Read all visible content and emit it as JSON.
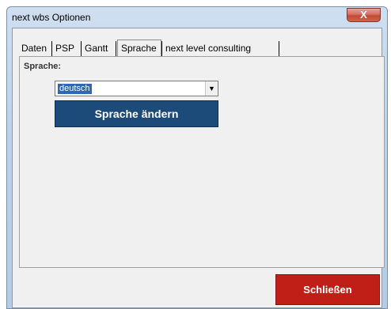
{
  "window": {
    "title": "next wbs Optionen",
    "close_glyph": "X"
  },
  "tabs": [
    {
      "label": "Daten",
      "active": false
    },
    {
      "label": "PSP",
      "active": false
    },
    {
      "label": "Gantt",
      "active": false
    },
    {
      "label": "Sprache",
      "active": true
    },
    {
      "label": "next level consulting",
      "active": false
    }
  ],
  "sprache": {
    "label": "Sprache:",
    "selected": "deutsch",
    "change_button": "Sprache ändern"
  },
  "footer": {
    "close_button": "Schließen"
  },
  "colors": {
    "primary_button": "#1c4a79",
    "close_button": "#c01f17",
    "selection": "#3165b5"
  },
  "icons": {
    "dropdown": "chevron-down-icon",
    "window_close": "close-icon"
  }
}
